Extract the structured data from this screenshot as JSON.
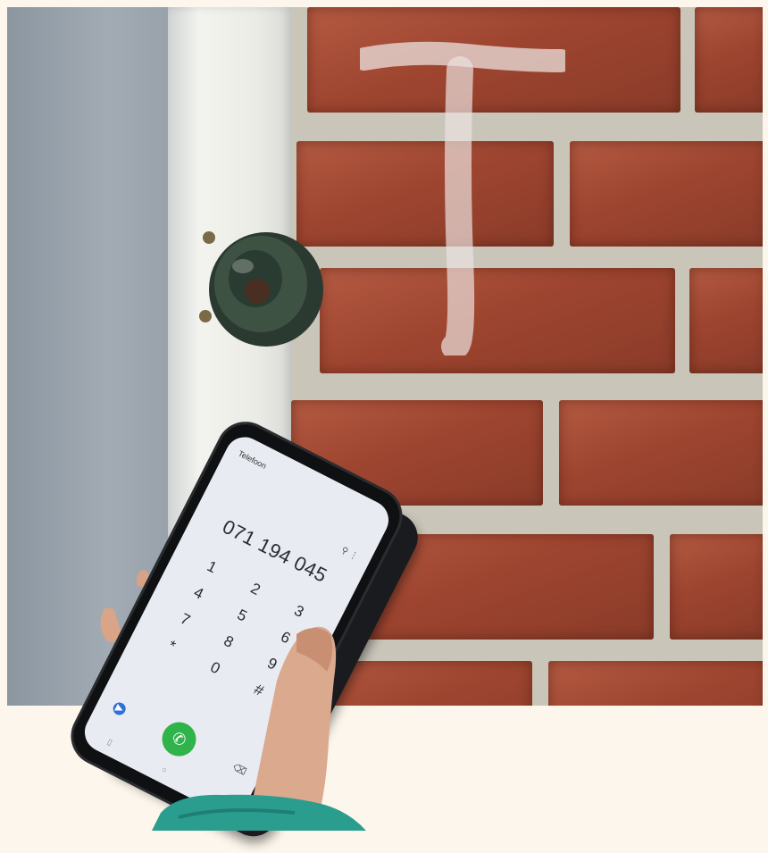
{
  "phone": {
    "app_title": "Telefoon",
    "dialed_number": "071 194 045",
    "keypad": [
      "1",
      "2",
      "3",
      "4",
      "5",
      "6",
      "7",
      "8",
      "9",
      "*",
      "0",
      "#"
    ],
    "call_icon": "phone-call-icon",
    "video_icon": "video-call-icon",
    "delete_icon": "backspace-icon"
  },
  "colors": {
    "brick": "#9e4530",
    "mortar": "#c9c5b9",
    "door_frame": "#f0f0eb",
    "door": "#9aa3ac",
    "background": "#fcf6ec",
    "call_button": "#2fb34a"
  }
}
